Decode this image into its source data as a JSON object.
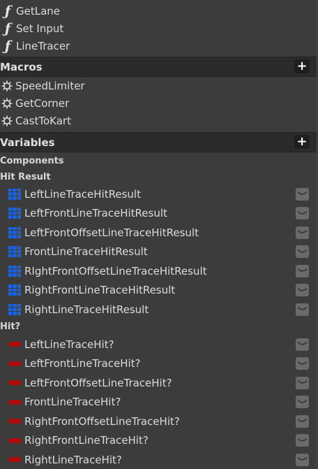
{
  "functions": [
    {
      "label": "GetLane",
      "icon": "function-icon"
    },
    {
      "label": "Set Input",
      "icon": "function-icon"
    },
    {
      "label": "LineTracer",
      "icon": "function-icon"
    }
  ],
  "macros_header": {
    "title": "Macros",
    "add_label": "+"
  },
  "macros": [
    {
      "label": "SpeedLimiter",
      "icon": "macro-gear-icon"
    },
    {
      "label": "GetCorner",
      "icon": "macro-gear-icon"
    },
    {
      "label": "CastToKart",
      "icon": "macro-gear-icon"
    }
  ],
  "variables_header": {
    "title": "Variables",
    "add_label": "+"
  },
  "categories": {
    "components": "Components",
    "hit_result": "Hit Result",
    "hit": "Hit?"
  },
  "hit_result_vars": [
    "LeftLineTraceHitResult",
    "LeftFrontLineTraceHitResult",
    "LeftFrontOffsetLineTraceHitResult",
    "FrontLineTraceHitResult",
    "RIghtFrontOffsetLineTraceHitResult",
    "RightFrontLineTraceHitResult",
    "RightLineTraceHitResult"
  ],
  "hit_vars": [
    "LeftLineTraceHit?",
    "LeftFrontLineTraceHit?",
    "LeftFrontOffsetLineTraceHit?",
    "FrontLineTraceHit?",
    "RightFrontOffsetLineTraceHit?",
    "RightFrontLineTraceHit?",
    "RightLineTraceHit?"
  ],
  "colors": {
    "struct_var": "#1d62d6",
    "bool_var": "#b00c0c",
    "header_bg": "#2b2b2b",
    "panel_bg": "#3c3c3c"
  }
}
